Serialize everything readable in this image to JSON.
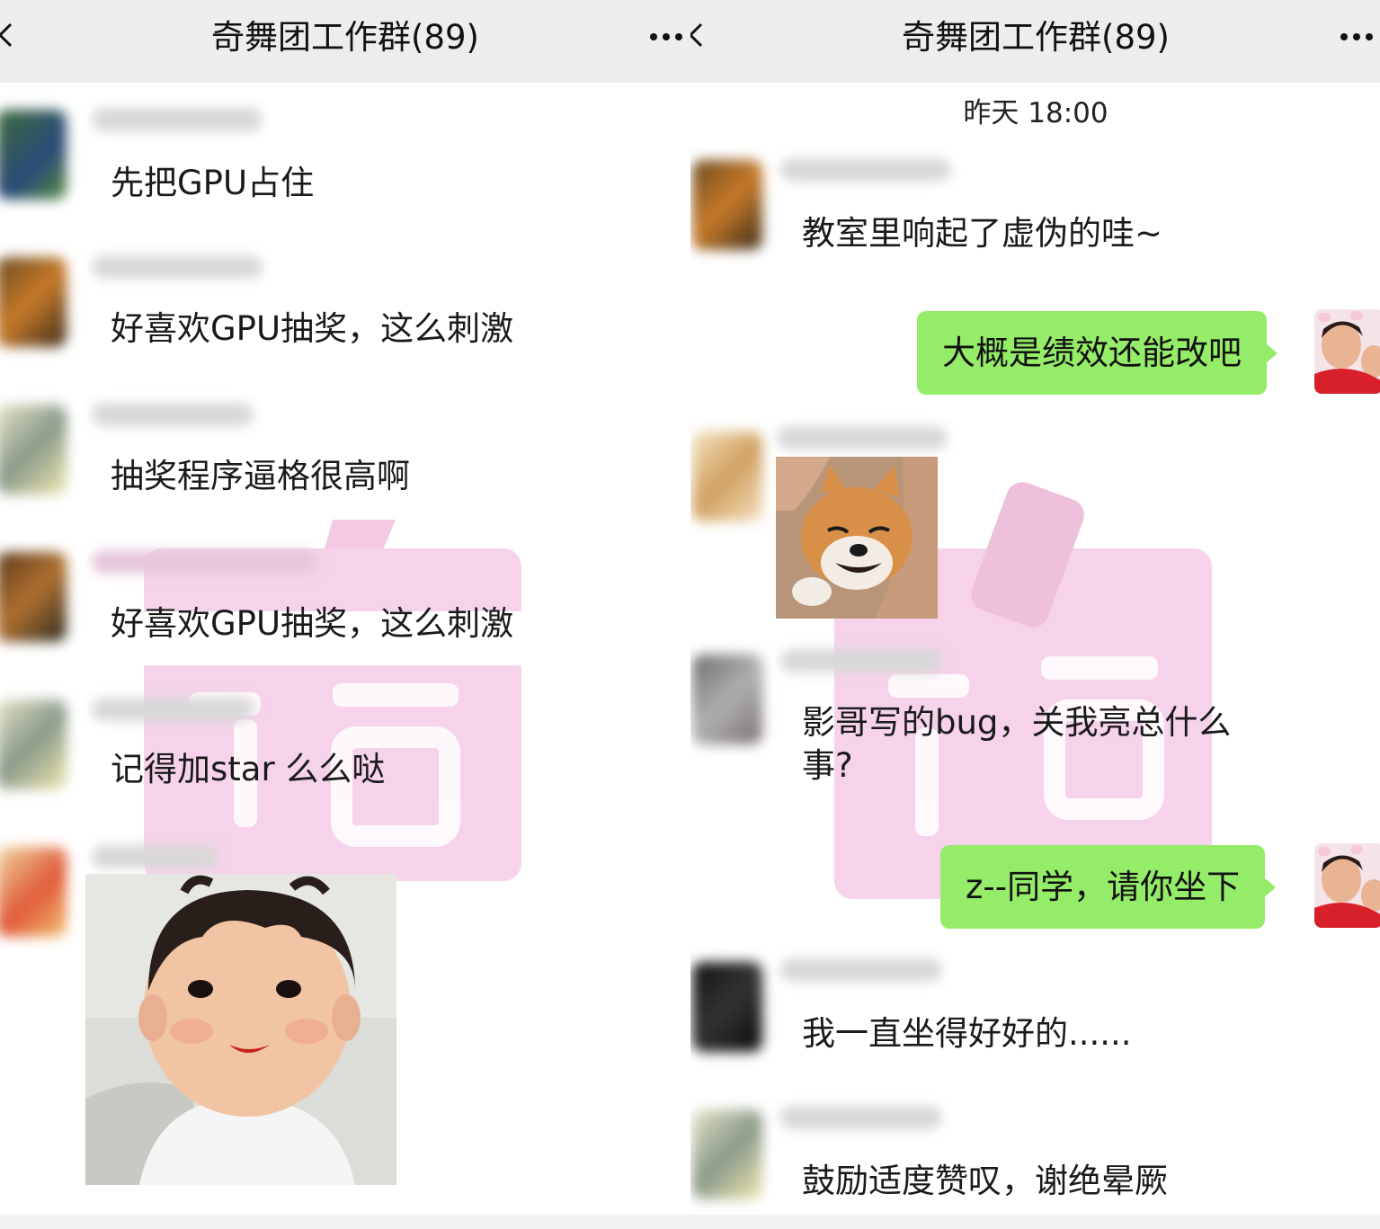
{
  "left": {
    "title": "奇舞团工作群(89)",
    "messages": [
      "先把GPU占住",
      "好喜欢GPU抽奖，这么刺激",
      "抽奖程序逼格很高啊",
      "好喜欢GPU抽奖，这么刺激",
      "记得加star 么么哒"
    ]
  },
  "right": {
    "title": "奇舞团工作群(89)",
    "timestamp": "昨天 18:00",
    "messages": [
      "教室里响起了虚伪的哇~",
      "大概是绩效还能改吧",
      "影哥写的bug，关我亮总什么事?",
      "z--同学，请你坐下",
      "我一直坐得好好的......",
      "鼓励适度赞叹，谢绝晕厥"
    ]
  },
  "icons": {
    "back": "chevron-left-icon",
    "more": "more-dots-icon"
  },
  "colors": {
    "self_bubble": "#95ec69",
    "header_bg": "#ededed",
    "watermark": "#f3c9e4"
  }
}
